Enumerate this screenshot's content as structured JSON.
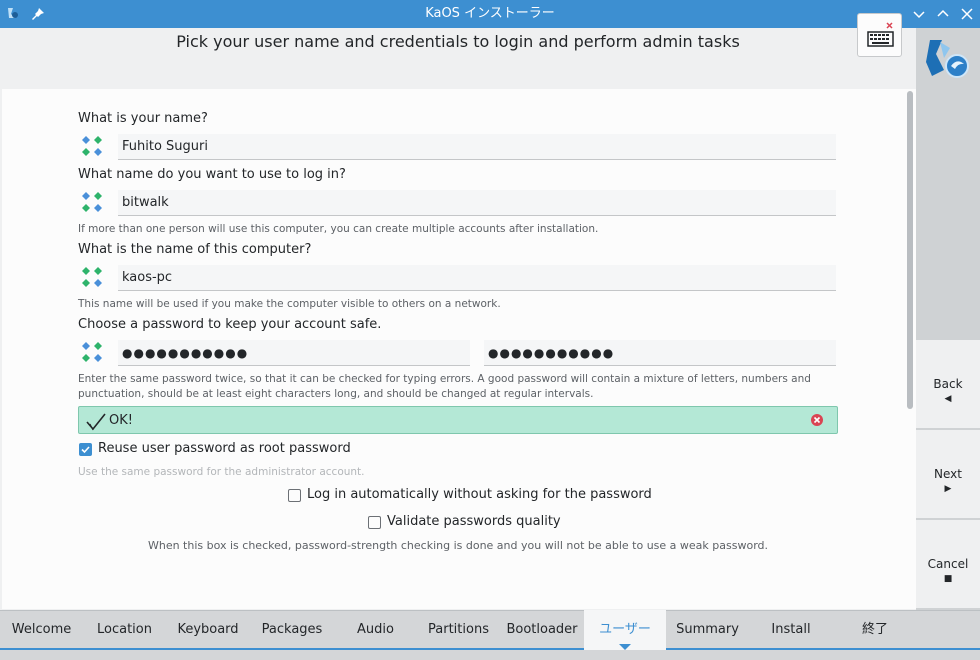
{
  "window": {
    "title": "KaOS インストーラー"
  },
  "header": {
    "heading": "Pick your user name and credentials to login and perform admin tasks"
  },
  "form": {
    "name_label": "What is your name?",
    "name_value": "Fuhito Suguri",
    "login_label": "What name do you want to use to log in?",
    "login_value": "bitwalk",
    "login_hint": "If more than one person will use this computer, you can create multiple accounts after installation.",
    "host_label": "What is the name of this computer?",
    "host_value": "kaos-pc",
    "host_hint": "This name will be used if you make the computer visible to others on a network.",
    "password_label": "Choose a password to keep your account safe.",
    "password_value": "●●●●●●●●●●●",
    "password_confirm_value": "●●●●●●●●●●●",
    "password_hint_1": "Enter the same password twice, so that it can be checked for typing errors. A good password will contain a mixture of letters, numbers and",
    "password_hint_2": "punctuation, should be at least eight characters long, and should be changed at regular intervals.",
    "status_message": "OK!",
    "reuse_root_label": "Reuse user password as root password",
    "reuse_root_checked": true,
    "reuse_root_hint": "Use the same password for the administrator account.",
    "autologin_label": "Log in automatically without asking for the password",
    "autologin_checked": false,
    "validate_quality_label": "Validate passwords quality",
    "validate_quality_checked": false,
    "validate_hint": "When this box is checked, password-strength checking is done and you will not be able to use a weak password."
  },
  "nav": {
    "back_label": "Back",
    "next_label": "Next",
    "cancel_label": "Cancel"
  },
  "steps": [
    {
      "label": "Welcome"
    },
    {
      "label": "Location"
    },
    {
      "label": "Keyboard"
    },
    {
      "label": "Packages"
    },
    {
      "label": "Audio"
    },
    {
      "label": "Partitions"
    },
    {
      "label": "Bootloader"
    },
    {
      "label": "ユーザー",
      "active": true
    },
    {
      "label": "Summary"
    },
    {
      "label": "Install"
    },
    {
      "label": "終了"
    }
  ],
  "colors": {
    "accent": "#3d8fd1",
    "ok_background": "#b4e8d6",
    "error_red": "#da4453"
  }
}
